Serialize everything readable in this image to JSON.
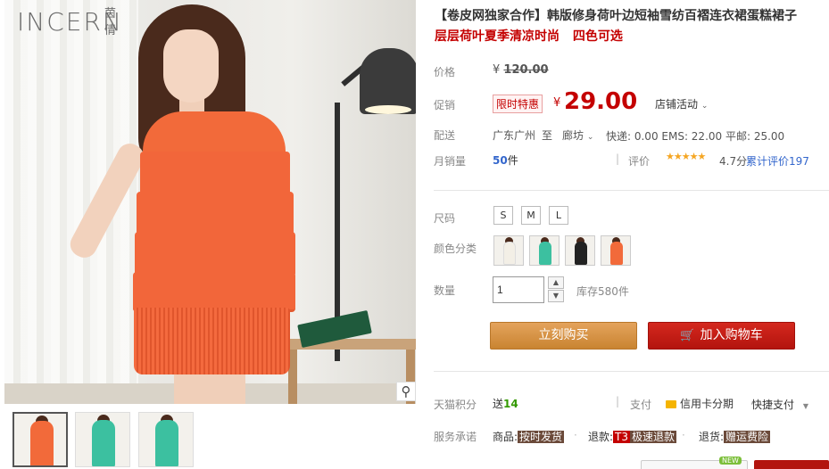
{
  "gallery": {
    "logo_text": "INCERN",
    "logo_cn": "茵倩",
    "zoom_icon": "magnifier-icon",
    "thumbnail_colors": [
      "#f26a3a",
      "#3cc0a0",
      "#3cc0a0"
    ]
  },
  "product": {
    "title": "【卷皮网独家合作】韩版修身荷叶边短袖雪纺百褶连衣裙蛋糕裙子",
    "subtitle": "层层荷叶夏季清凉时尚   四色可选"
  },
  "price": {
    "label": "价格",
    "currency": "¥",
    "original": "120.00"
  },
  "promotion": {
    "label": "促销",
    "tag": "限时特惠",
    "currency": "¥",
    "price": "29.00",
    "shop_activity": "店铺活动",
    "shop_activity_icon": "chevron-down-icon"
  },
  "shipping": {
    "label": "配送",
    "from": "广东广州",
    "to_word": "至",
    "destination": "廊坊",
    "fees": "快递: 0.00  EMS: 22.00  平邮: 25.00"
  },
  "sales": {
    "label": "月销量",
    "count": "50",
    "unit": "件",
    "rating_label": "评价",
    "stars": "★★★★★",
    "score_text": "4.7分",
    "review_label": "累计评价",
    "review_count": "197"
  },
  "size": {
    "label": "尺码",
    "options": [
      "S",
      "M",
      "L"
    ]
  },
  "color": {
    "label": "颜色分类",
    "swatches": [
      "#f3efe6",
      "#3cc0a0",
      "#222222",
      "#f26a3a"
    ]
  },
  "quantity": {
    "label": "数量",
    "value": "1",
    "stock": "库存580件"
  },
  "actions": {
    "buy_now": "立刻购买",
    "add_to_cart": "加入购物车",
    "cart_icon": "shopping-cart-icon"
  },
  "points": {
    "label": "天猫积分",
    "prefix": "送",
    "value": "14",
    "pay_label": "支付",
    "credit_card": "信用卡分期",
    "quick_pay": "快捷支付",
    "dropdown_icon": "triangle-down-icon"
  },
  "service": {
    "label": "服务承诺",
    "goods_prefix": "商品:",
    "goods_tag": "按时发货",
    "refund_prefix": "退款:",
    "refund_t3": "T3",
    "refund_tag": "极速退款",
    "return_prefix": "退货:",
    "return_tag": "赠运费险"
  },
  "footer": {
    "new_badge": "NEW"
  }
}
